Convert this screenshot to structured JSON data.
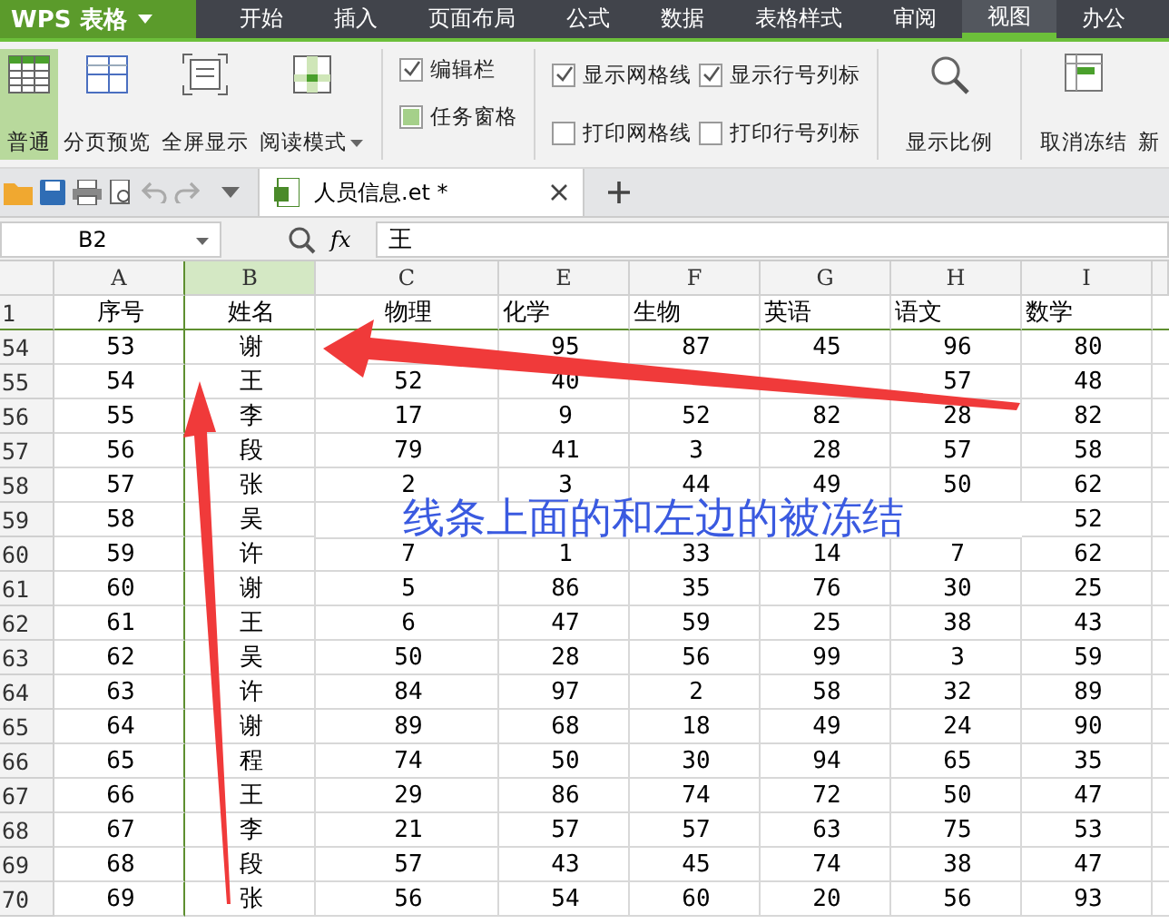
{
  "app": {
    "logo": "WPS 表格"
  },
  "menu_tabs": [
    {
      "label": "开始",
      "selected": false
    },
    {
      "label": "插入",
      "selected": false
    },
    {
      "label": "页面布局",
      "selected": false
    },
    {
      "label": "公式",
      "selected": false
    },
    {
      "label": "数据",
      "selected": false
    },
    {
      "label": "表格样式",
      "selected": false
    },
    {
      "label": "审阅",
      "selected": false
    },
    {
      "label": "视图",
      "selected": true
    },
    {
      "label": "办公",
      "selected": false
    }
  ],
  "view_buttons": [
    {
      "label": "普通",
      "selected": true
    },
    {
      "label": "分页预览",
      "selected": false
    },
    {
      "label": "全屏显示",
      "selected": false
    },
    {
      "label": "阅读模式",
      "selected": false,
      "dropdown": true
    }
  ],
  "option_groups": [
    [
      {
        "label": "编辑栏",
        "kind": "check",
        "checked": true
      },
      {
        "label": "任务窗格",
        "kind": "pane",
        "checked": true
      }
    ],
    [
      {
        "label": "显示网格线",
        "kind": "check",
        "checked": true
      },
      {
        "label": "打印网格线",
        "kind": "check",
        "checked": false
      }
    ],
    [
      {
        "label": "显示行号列标",
        "kind": "check",
        "checked": true
      },
      {
        "label": "打印行号列标",
        "kind": "check",
        "checked": false
      }
    ]
  ],
  "zoom_button": {
    "label": "显示比例"
  },
  "freeze_buttons": [
    {
      "label": "取消冻结"
    },
    {
      "label": "新"
    }
  ],
  "doc_tab": {
    "title": "人员信息.et *"
  },
  "formula_bar": {
    "cell": "B2",
    "fx": "fx",
    "value": "王"
  },
  "sheet": {
    "columns": [
      {
        "label": "A",
        "selected": false
      },
      {
        "label": "B",
        "selected": true
      },
      {
        "label": "C",
        "selected": false
      },
      {
        "label": "E",
        "selected": false
      },
      {
        "label": "F",
        "selected": false
      },
      {
        "label": "G",
        "selected": false
      },
      {
        "label": "H",
        "selected": false
      },
      {
        "label": "I",
        "selected": false
      }
    ],
    "header_row": {
      "number": "1",
      "cells": [
        "序号",
        "姓名",
        "物理",
        "化学",
        "生物",
        "英语",
        "语文",
        "数学"
      ]
    },
    "rows": [
      {
        "number": "54",
        "cells": [
          "53",
          "谢",
          null,
          "95",
          "87",
          "45",
          "96",
          "80"
        ]
      },
      {
        "number": "55",
        "cells": [
          "54",
          "王",
          "52",
          "40",
          null,
          null,
          "57",
          "48"
        ]
      },
      {
        "number": "56",
        "cells": [
          "55",
          "李",
          "17",
          "9",
          "52",
          "82",
          "28",
          "82"
        ]
      },
      {
        "number": "57",
        "cells": [
          "56",
          "段",
          "79",
          "41",
          "3",
          "28",
          "57",
          "58"
        ]
      },
      {
        "number": "58",
        "cells": [
          "57",
          "张",
          "2",
          "3",
          "44",
          "49",
          "50",
          "62"
        ]
      },
      {
        "number": "59",
        "cells": [
          "58",
          "吴",
          null,
          null,
          null,
          null,
          null,
          "52"
        ]
      },
      {
        "number": "60",
        "cells": [
          "59",
          "许",
          "7",
          "1",
          "33",
          "14",
          "7",
          "62"
        ]
      },
      {
        "number": "61",
        "cells": [
          "60",
          "谢",
          "5",
          "86",
          "35",
          "76",
          "30",
          "25"
        ]
      },
      {
        "number": "62",
        "cells": [
          "61",
          "王",
          "6",
          "47",
          "59",
          "25",
          "38",
          "43"
        ]
      },
      {
        "number": "63",
        "cells": [
          "62",
          "吴",
          "50",
          "28",
          "56",
          "99",
          "3",
          "59"
        ]
      },
      {
        "number": "64",
        "cells": [
          "63",
          "许",
          "84",
          "97",
          "2",
          "58",
          "32",
          "89"
        ]
      },
      {
        "number": "65",
        "cells": [
          "64",
          "谢",
          "89",
          "68",
          "18",
          "49",
          "24",
          "90"
        ]
      },
      {
        "number": "66",
        "cells": [
          "65",
          "程",
          "74",
          "50",
          "30",
          "94",
          "65",
          "35"
        ]
      },
      {
        "number": "67",
        "cells": [
          "66",
          "王",
          "29",
          "86",
          "74",
          "72",
          "50",
          "47"
        ]
      },
      {
        "number": "68",
        "cells": [
          "67",
          "李",
          "21",
          "57",
          "57",
          "63",
          "75",
          "53"
        ]
      },
      {
        "number": "69",
        "cells": [
          "68",
          "段",
          "57",
          "43",
          "45",
          "74",
          "38",
          "47"
        ]
      },
      {
        "number": "70",
        "cells": [
          "69",
          "张",
          "56",
          "54",
          "60",
          "20",
          "56",
          "93"
        ]
      }
    ]
  },
  "annotation": {
    "text": "线条上面的和左边的被冻结"
  }
}
